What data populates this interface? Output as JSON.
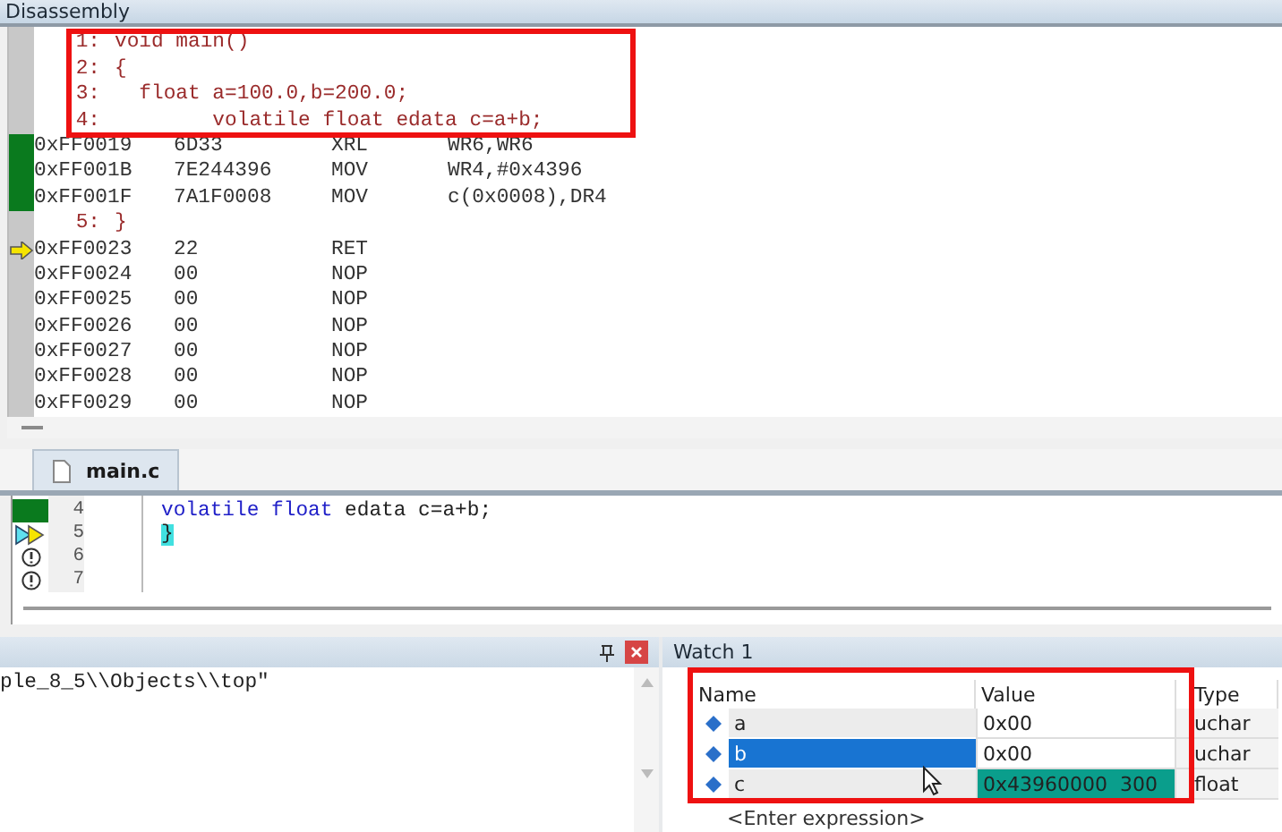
{
  "disassembly": {
    "title": "Disassembly",
    "rows": [
      {
        "kind": "source",
        "line": "1:",
        "text": "void main()",
        "covered": false,
        "current": false
      },
      {
        "kind": "source",
        "line": "2:",
        "text": "{",
        "covered": false,
        "current": false
      },
      {
        "kind": "source",
        "line": "3:",
        "text": "  float a=100.0,b=200.0;",
        "covered": false,
        "current": false
      },
      {
        "kind": "source",
        "line": "4:",
        "text": "        volatile float edata c=a+b;",
        "covered": false,
        "current": false
      },
      {
        "kind": "asm",
        "address": "0xFF0019",
        "opcode": "6D33",
        "mnemonic": "XRL",
        "operands": "WR6,WR6",
        "covered": true,
        "current": false
      },
      {
        "kind": "asm",
        "address": "0xFF001B",
        "opcode": "7E244396",
        "mnemonic": "MOV",
        "operands": "WR4,#0x4396",
        "covered": true,
        "current": false
      },
      {
        "kind": "asm",
        "address": "0xFF001F",
        "opcode": "7A1F0008",
        "mnemonic": "MOV",
        "operands": "c(0x0008),DR4",
        "covered": true,
        "current": false
      },
      {
        "kind": "source",
        "line": "5:",
        "text": "}",
        "covered": false,
        "current": false
      },
      {
        "kind": "asm",
        "address": "0xFF0023",
        "opcode": "22",
        "mnemonic": "RET",
        "covered": false,
        "current": true
      },
      {
        "kind": "asm",
        "address": "0xFF0024",
        "opcode": "00",
        "mnemonic": "NOP",
        "covered": false,
        "current": false
      },
      {
        "kind": "asm",
        "address": "0xFF0025",
        "opcode": "00",
        "mnemonic": "NOP",
        "covered": false,
        "current": false
      },
      {
        "kind": "asm",
        "address": "0xFF0026",
        "opcode": "00",
        "mnemonic": "NOP",
        "covered": false,
        "current": false
      },
      {
        "kind": "asm",
        "address": "0xFF0027",
        "opcode": "00",
        "mnemonic": "NOP",
        "covered": false,
        "current": false
      },
      {
        "kind": "asm",
        "address": "0xFF0028",
        "opcode": "00",
        "mnemonic": "NOP",
        "covered": false,
        "current": false
      },
      {
        "kind": "asm",
        "address": "0xFF0029",
        "opcode": "00",
        "mnemonic": "NOP",
        "covered": false,
        "current": false
      }
    ]
  },
  "editor": {
    "tabs": [
      {
        "label": "main.c",
        "selected": true
      }
    ],
    "lines": [
      {
        "number": "4",
        "kind": "executed",
        "tokens": [
          {
            "text": "volatile float",
            "kind": "keyword"
          },
          {
            "text": "edata c=a+b;",
            "kind": "plain"
          }
        ]
      },
      {
        "number": "5",
        "kind": "current",
        "tokens": [
          {
            "text": "}",
            "kind": "brace"
          }
        ]
      },
      {
        "number": "6",
        "kind": "warning"
      },
      {
        "number": "7",
        "kind": "warning"
      }
    ]
  },
  "command": {
    "output": "ple_8_5\\\\Objects\\\\top\""
  },
  "watch": {
    "title": "Watch 1",
    "columns": [
      "Name",
      "Value",
      "Type"
    ],
    "rows": [
      {
        "name": "a",
        "value": "0x00",
        "type": "uchar",
        "selected": false,
        "changed": false
      },
      {
        "name": "b",
        "value": "0x00",
        "type": "uchar",
        "selected": true,
        "changed": false
      },
      {
        "name": "c",
        "value": "0x43960000  300",
        "type": "float",
        "selected": false,
        "changed": true
      }
    ],
    "placeholder": "<Enter expression>"
  }
}
